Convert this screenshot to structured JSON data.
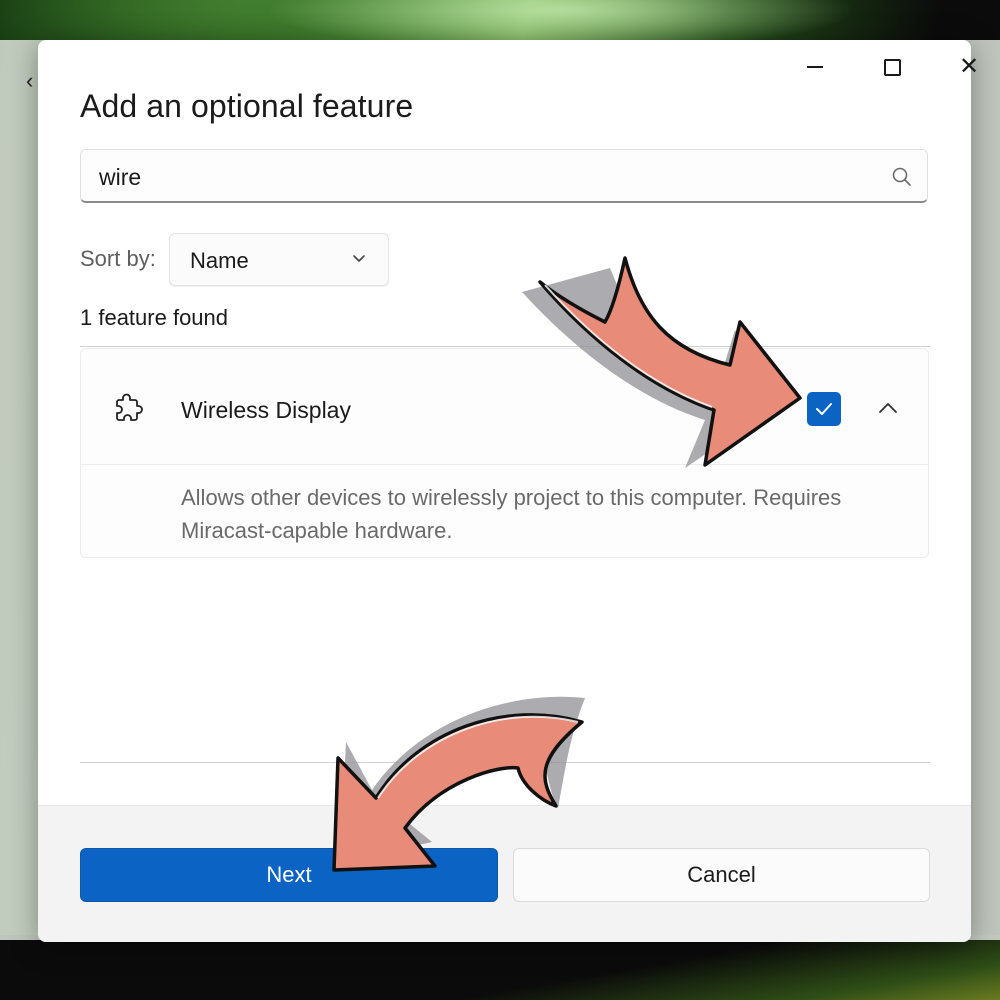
{
  "window": {
    "minimize_icon": "minimize-icon",
    "maximize_icon": "maximize-icon",
    "close_icon": "close-icon",
    "back_icon": "back-arrow-icon"
  },
  "dialog": {
    "title": "Add an optional feature",
    "search": {
      "value": "wire",
      "icon": "search-icon"
    },
    "sort": {
      "label": "Sort by:",
      "selected": "Name",
      "icon": "chevron-down-icon"
    },
    "results_count": "1 feature found",
    "features": [
      {
        "name": "Wireless Display",
        "icon": "puzzle-icon",
        "checked": true,
        "expanded": true,
        "description": "Allows other devices to wirelessly project to this computer. Requires Miracast-capable hardware."
      }
    ],
    "buttons": {
      "next": "Next",
      "cancel": "Cancel"
    }
  },
  "colors": {
    "accent": "#0b63c3",
    "annotation_arrow": "#e88b78"
  }
}
